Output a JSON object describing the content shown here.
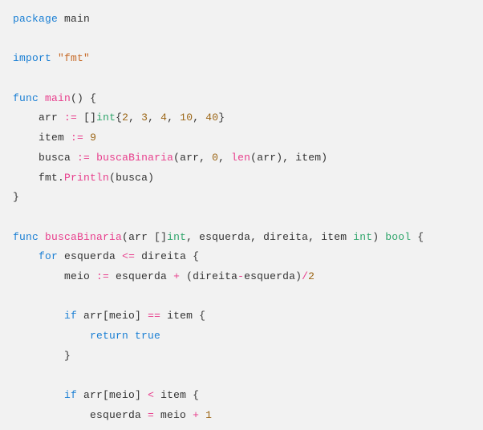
{
  "code": {
    "l1": {
      "kw_package": "package",
      "name": "main"
    },
    "l3": {
      "kw_import": "import",
      "pkg": "\"fmt\""
    },
    "l5": {
      "kw_func": "func",
      "fn": "main",
      "parens": "()",
      "brace": " {"
    },
    "l6": {
      "indent": "    ",
      "ident": "arr ",
      "op": ":=",
      "sp": " ",
      "brack": "[]",
      "type": "int",
      "open": "{",
      "n1": "2",
      "c": ", ",
      "n2": "3",
      "n3": "4",
      "n4": "10",
      "n5": "40",
      "close": "}"
    },
    "l7": {
      "indent": "    ",
      "ident": "item ",
      "op": ":=",
      "sp": " ",
      "num": "9"
    },
    "l8": {
      "indent": "    ",
      "ident": "busca ",
      "op": ":=",
      "sp": " ",
      "fn": "buscaBinaria",
      "open": "(",
      "a1": "arr",
      "c": ", ",
      "n0": "0",
      "lenfn": "len",
      "lopen": "(",
      "larg": "arr",
      "lclose": ")",
      "a4": "item",
      "close": ")"
    },
    "l9": {
      "indent": "    ",
      "obj": "fmt",
      "dot": ".",
      "fn": "Println",
      "open": "(",
      "arg": "busca",
      "close": ")"
    },
    "l10": {
      "brace": "}"
    },
    "l12": {
      "kw_func": "func",
      "fn": "buscaBinaria",
      "open": "(",
      "p1": "arr ",
      "brack": "[]",
      "t1": "int",
      "c": ", ",
      "p2": "esquerda",
      "p3": "direita",
      "p4": "item ",
      "t2": "int",
      "close": ")",
      "sp": " ",
      "ret": "bool",
      "brace": " {"
    },
    "l13": {
      "indent": "    ",
      "kw": "for",
      "sp": " ",
      "a": "esquerda ",
      "op": "<=",
      "b": " direita {"
    },
    "l14": {
      "indent": "        ",
      "ident": "meio ",
      "op": ":=",
      "rest1": " esquerda ",
      "plus": "+",
      "rest2": " (direita",
      "minus": "-",
      "rest3": "esquerda)",
      "div": "/",
      "two": "2"
    },
    "l16": {
      "indent": "        ",
      "kw": "if",
      "sp": " ",
      "a": "arr[meio] ",
      "op": "==",
      "b": " item {"
    },
    "l17": {
      "indent": "            ",
      "kw": "return",
      "sp": " ",
      "val": "true"
    },
    "l18": {
      "indent": "        ",
      "brace": "}"
    },
    "l20": {
      "indent": "        ",
      "kw": "if",
      "sp": " ",
      "a": "arr[meio] ",
      "op": "<",
      "b": " item {"
    },
    "l21": {
      "indent": "            ",
      "a": "esquerda ",
      "eq": "=",
      "b": " meio ",
      "plus": "+",
      "sp": " ",
      "one": "1"
    }
  }
}
